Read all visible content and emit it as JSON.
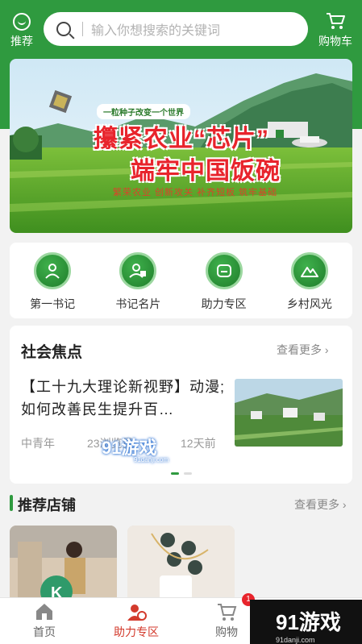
{
  "header": {
    "recommend_label": "推荐",
    "search_placeholder": "输入你想搜索的关键词",
    "cart_label": "购物车"
  },
  "banner": {
    "small_caption": "一粒种子改变一个世界",
    "line1": "攥紧农业“芯片”",
    "line2": "端牢中国饭碗",
    "tags": "繁荣农业  创新攻关  补齐短板  筑牢基础"
  },
  "menu": [
    {
      "label": "第一书记",
      "icon": "person-badge-icon"
    },
    {
      "label": "书记名片",
      "icon": "person-card-icon"
    },
    {
      "label": "助力专区",
      "icon": "helping-hands-icon"
    },
    {
      "label": "乡村风光",
      "icon": "mountain-icon"
    }
  ],
  "focus": {
    "title": "社会焦点",
    "more": "查看更多",
    "news": {
      "title": "【工十九大理论新视野】动漫;如何改善民生提升百…",
      "source": "中青年",
      "views": "23浏览量",
      "time": "12天前"
    }
  },
  "shops": {
    "title": "推荐店铺",
    "more": "查看更多"
  },
  "tabbar": {
    "items": [
      {
        "label": "首页",
        "icon": "home-icon"
      },
      {
        "label": "助力专区",
        "icon": "helping-hands-icon"
      },
      {
        "label": "购物",
        "icon": "cart-icon"
      }
    ],
    "badge": "1"
  },
  "watermark": {
    "text": "91游戏",
    "sub": "91danji.com"
  },
  "colors": {
    "brand_green": "#2f9a3f",
    "accent_red": "#e8242c"
  }
}
